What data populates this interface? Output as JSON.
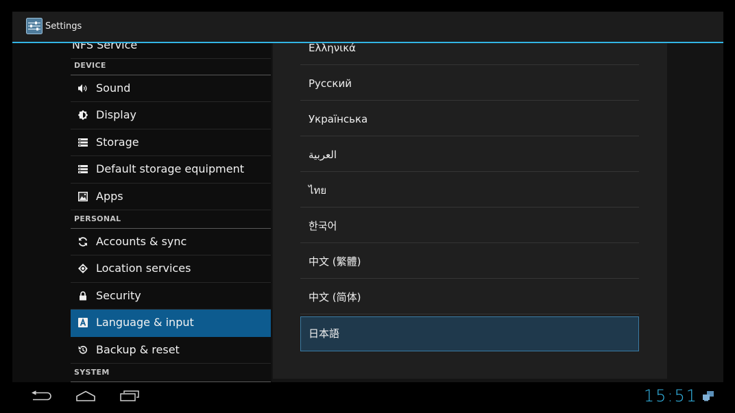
{
  "action_bar": {
    "icon": "settings-sliders-icon",
    "title": "Settings"
  },
  "settings_list": {
    "partial_top_item": "NFS Service",
    "device_header": "DEVICE",
    "device_items": [
      {
        "label": "Sound",
        "icon": "sound-icon",
        "selected": false
      },
      {
        "label": "Display",
        "icon": "display-brightness-icon",
        "selected": false
      },
      {
        "label": "Storage",
        "icon": "storage-icon",
        "selected": false
      },
      {
        "label": "Default storage equipment",
        "icon": "storage-icon",
        "selected": false
      },
      {
        "label": "Apps",
        "icon": "apps-icon",
        "selected": false
      }
    ],
    "personal_header": "PERSONAL",
    "personal_items": [
      {
        "label": "Accounts & sync",
        "icon": "sync-icon",
        "selected": false
      },
      {
        "label": "Location services",
        "icon": "location-icon",
        "selected": false
      },
      {
        "label": "Security",
        "icon": "lock-icon",
        "selected": false
      },
      {
        "label": "Language & input",
        "icon": "language-icon",
        "selected": true
      },
      {
        "label": "Backup & reset",
        "icon": "backup-restore-icon",
        "selected": false
      }
    ],
    "system_header": "SYSTEM"
  },
  "language_list": {
    "partial_top_item": "Ελληνικά",
    "items": [
      {
        "label": "Русский",
        "selected": false
      },
      {
        "label": "Українська",
        "selected": false
      },
      {
        "label": "العربية",
        "selected": false
      },
      {
        "label": "ไทย",
        "selected": false
      },
      {
        "label": "한국어",
        "selected": false
      },
      {
        "label": "中文 (繁體)",
        "selected": false
      },
      {
        "label": "中文 (简体)",
        "selected": false
      },
      {
        "label": "日本語",
        "selected": true
      }
    ]
  },
  "navigation_bar": {
    "back_icon": "back-icon",
    "home_icon": "home-icon",
    "recents_icon": "recent-apps-icon",
    "clock": "15:51",
    "status_icon": "usb-debugging-icon"
  },
  "colors": {
    "accent": "#33b5e5",
    "selected_setting_background": "#0d5b8f",
    "selected_language_background": "#1f394c",
    "selected_language_border": "#3b7ca5"
  }
}
